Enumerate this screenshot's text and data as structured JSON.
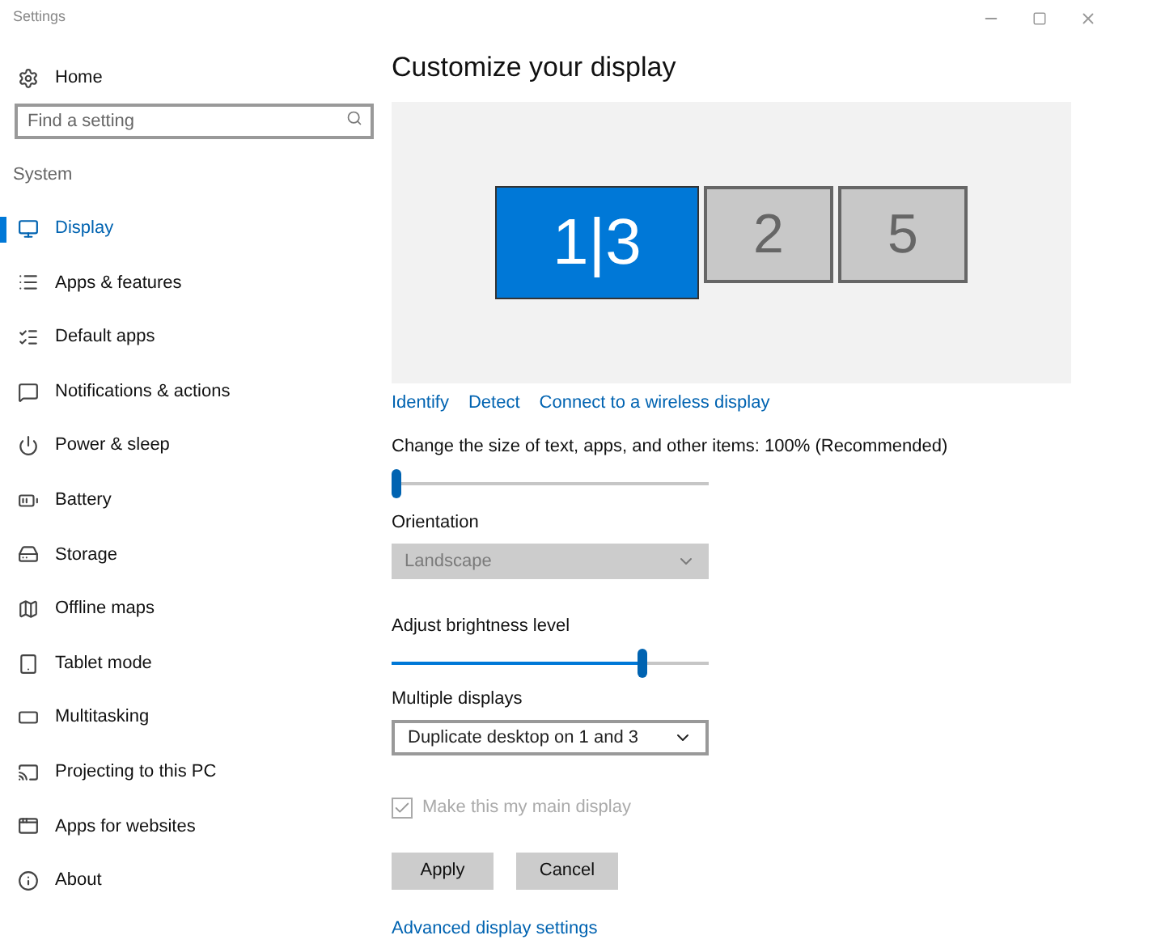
{
  "window": {
    "title": "Settings"
  },
  "sidebar": {
    "home": "Home",
    "search": {
      "placeholder": "Find a setting"
    },
    "section": "System",
    "items": [
      {
        "label": "Display",
        "selected": true
      },
      {
        "label": "Apps & features",
        "selected": false
      },
      {
        "label": "Default apps",
        "selected": false
      },
      {
        "label": "Notifications & actions",
        "selected": false
      },
      {
        "label": "Power & sleep",
        "selected": false
      },
      {
        "label": "Battery",
        "selected": false
      },
      {
        "label": "Storage",
        "selected": false
      },
      {
        "label": "Offline maps",
        "selected": false
      },
      {
        "label": "Tablet mode",
        "selected": false
      },
      {
        "label": "Multitasking",
        "selected": false
      },
      {
        "label": "Projecting to this PC",
        "selected": false
      },
      {
        "label": "Apps for websites",
        "selected": false
      },
      {
        "label": "About",
        "selected": false
      }
    ]
  },
  "main": {
    "title": "Customize your display",
    "monitors": [
      {
        "label": "1|3",
        "selected": true
      },
      {
        "label": "2",
        "selected": false
      },
      {
        "label": "5",
        "selected": false
      }
    ],
    "links": [
      "Identify",
      "Detect",
      "Connect to a wireless display"
    ],
    "scale": {
      "label": "Change the size of text, apps, and other items: 100% (Recommended)",
      "level": 0.0
    },
    "orientation": {
      "label": "Orientation",
      "value": "Landscape",
      "disabled": true
    },
    "brightness": {
      "label": "Adjust brightness level",
      "level": 0.8
    },
    "multiple": {
      "label": "Multiple displays",
      "value": "Duplicate desktop on 1 and 3",
      "disabled": false
    },
    "main_display": {
      "label": "Make this my main display",
      "checked": true,
      "disabled": true
    },
    "buttons": [
      "Apply",
      "Cancel"
    ],
    "advanced_link": "Advanced display settings"
  }
}
